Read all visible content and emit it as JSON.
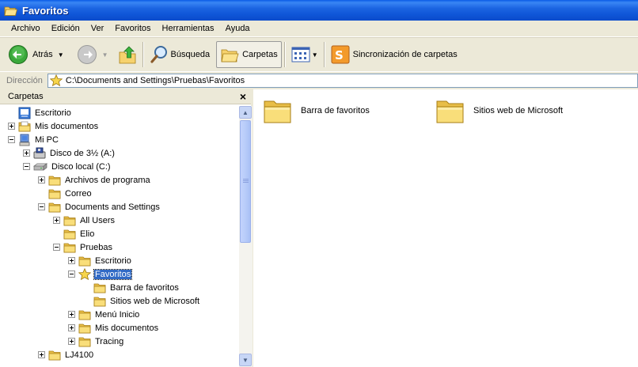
{
  "window": {
    "title": "Favoritos",
    "icon": "folder-open-icon"
  },
  "menu": [
    "Archivo",
    "Edición",
    "Ver",
    "Favoritos",
    "Herramientas",
    "Ayuda"
  ],
  "toolbar": {
    "back_label": "Atrás",
    "search_label": "Búsqueda",
    "folders_label": "Carpetas",
    "sync_label": "Sincronización de carpetas"
  },
  "address": {
    "label": "Dirección",
    "value": "C:\\Documents and Settings\\Pruebas\\Favoritos"
  },
  "folders_pane": {
    "title": "Carpetas",
    "close": "×"
  },
  "tree": [
    {
      "label": "Escritorio",
      "icon": "desktop-icon",
      "expander": "none",
      "selected": false
    },
    {
      "label": "Mis documentos",
      "icon": "my-documents-icon",
      "expander": "plus",
      "selected": false
    },
    {
      "label": "Mi PC",
      "icon": "my-computer-icon",
      "expander": "minus",
      "selected": false
    },
    {
      "label": "Disco de 3½ (A:)",
      "icon": "floppy-icon",
      "expander": "plus",
      "selected": false
    },
    {
      "label": "Disco local (C:)",
      "icon": "hard-drive-icon",
      "expander": "minus",
      "selected": false
    },
    {
      "label": "Archivos de programa",
      "icon": "folder-icon",
      "expander": "plus",
      "selected": false
    },
    {
      "label": "Correo",
      "icon": "folder-icon",
      "expander": "none",
      "selected": false
    },
    {
      "label": "Documents and Settings",
      "icon": "folder-icon",
      "expander": "minus",
      "selected": false
    },
    {
      "label": "All Users",
      "icon": "folder-icon",
      "expander": "plus",
      "selected": false
    },
    {
      "label": "Elio",
      "icon": "folder-icon",
      "expander": "none",
      "selected": false
    },
    {
      "label": "Pruebas",
      "icon": "folder-icon",
      "expander": "minus",
      "selected": false
    },
    {
      "label": "Escritorio",
      "icon": "folder-icon",
      "expander": "plus",
      "selected": false
    },
    {
      "label": "Favoritos",
      "icon": "favorites-star-icon",
      "expander": "minus",
      "selected": true
    },
    {
      "label": "Barra de favoritos",
      "icon": "folder-icon",
      "expander": "none",
      "selected": false
    },
    {
      "label": "Sitios web de Microsoft",
      "icon": "folder-icon",
      "expander": "none",
      "selected": false
    },
    {
      "label": "Menú Inicio",
      "icon": "folder-icon",
      "expander": "plus",
      "selected": false
    },
    {
      "label": "Mis documentos",
      "icon": "folder-icon",
      "expander": "plus",
      "selected": false
    },
    {
      "label": "Tracing",
      "icon": "folder-icon",
      "expander": "plus",
      "selected": false
    },
    {
      "label": "LJ4100",
      "icon": "folder-icon",
      "expander": "plus",
      "selected": false
    }
  ],
  "content_items": [
    {
      "label": "Barra de favoritos",
      "icon": "large-folder-icon"
    },
    {
      "label": "Sitios web de Microsoft",
      "icon": "large-folder-icon"
    }
  ]
}
